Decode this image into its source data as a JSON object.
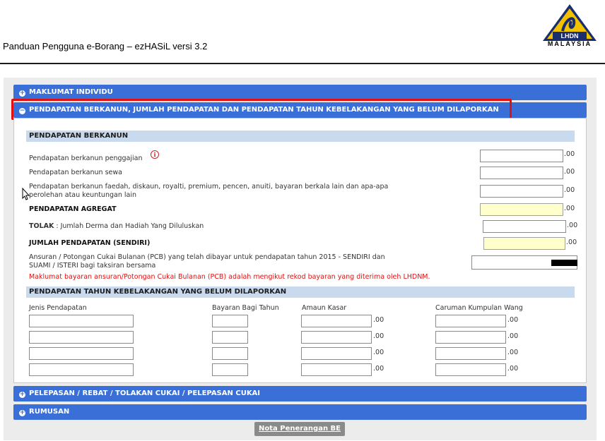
{
  "header": {
    "doc_title": "Panduan Pengguna e-Borang – ezHASiL versi 3.2",
    "logo_text": "LHDN",
    "logo_country": "MALAYSIA"
  },
  "sections": {
    "individu": "MAKLUMAT INDIVIDU",
    "pendapatan": "PENDAPATAN BERKANUN, JUMLAH PENDAPATAN DAN PENDAPATAN TAHUN KEBELAKANGAN YANG BELUM DILAPORKAN",
    "pelepasan": "PELEPASAN / REBAT / TOLAKAN CUKAI / PELEPASAN CUKAI",
    "rumusan": "RUMUSAN",
    "expanded_icon": "−",
    "collapsed_icon": "+"
  },
  "berkanun": {
    "title": "PENDAPATAN BERKANUN",
    "penggajian": "Pendapatan berkanun penggajian",
    "sewa": "Pendapatan berkanun sewa",
    "faedah_line1": "Pendapatan berkanun faedah, diskaun, royalti, premium, pencen, anuiti, bayaran berkala lain dan apa-apa",
    "faedah_line2": "perolehan atau keuntungan lain",
    "agregat": "PENDAPATAN AGREGAT",
    "tolak_bold": "TOLAK",
    "tolak_rest": " : Jumlah Derma dan Hadiah Yang Diluluskan",
    "jumlah": "JUMLAH PENDAPATAN (SENDIRI)",
    "pcb_line1": "Ansuran / Potongan Cukai Bulanan (PCB) yang telah dibayar untuk pendapatan tahun 2015 - SENDIRI dan",
    "pcb_line2": "SUAMI / ISTERI bagi taksiran bersama",
    "pcb_note": "Maklumat bayaran ansuran/Potongan Cukai Bulanan (PCB) adalah mengikut rekod bayaran yang diterima oleh LHDNM.",
    "decimal": ".00",
    "info_icon": "i"
  },
  "kebelakangan": {
    "title": "PENDAPATAN TAHUN KEBELAKANGAN YANG BELUM DILAPORKAN",
    "col_jenis": "Jenis Pendapatan",
    "col_tahun": "Bayaran Bagi Tahun",
    "col_amaun": "Amaun Kasar",
    "col_caruman": "Caruman Kumpulan Wang"
  },
  "footer": {
    "nota_button": "Nota Penerangan BE"
  }
}
